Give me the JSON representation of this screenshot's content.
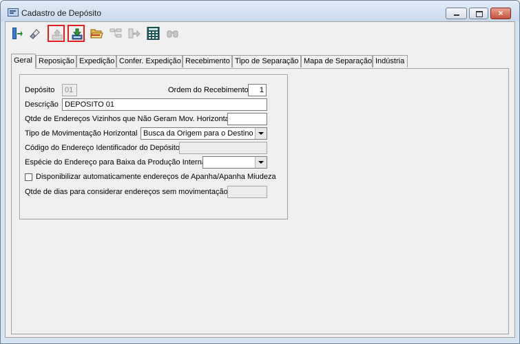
{
  "window": {
    "title": "Cadastro de Depósito",
    "close_glyph": "×"
  },
  "toolbar": {
    "buttons": [
      {
        "icon": "exit-icon"
      },
      {
        "icon": "eraser-icon"
      },
      {
        "icon": "insert-icon",
        "state": "disabled"
      },
      {
        "icon": "save-icon"
      },
      {
        "icon": "open-folder-icon"
      },
      {
        "icon": "tree-icon",
        "state": "disabled"
      },
      {
        "icon": "transfer-icon",
        "state": "disabled"
      },
      {
        "icon": "calculator-icon"
      },
      {
        "icon": "binoculars-icon",
        "state": "disabled"
      }
    ]
  },
  "tabs": [
    "Geral",
    "Reposição",
    "Expedição",
    "Confer. Expedição",
    "Recebimento",
    "Tipo de Separação",
    "Mapa de Separação",
    "Indústria"
  ],
  "selected_tab": "Geral",
  "form": {
    "deposito_label": "Depósito",
    "deposito_value": "01",
    "ordem_label": "Ordem do Recebimento",
    "ordem_value": "1",
    "descricao_label": "Descrição",
    "descricao_value": "DEPOSITO 01",
    "qtde_vizinhos_label": "Qtde de Endereços Vizinhos que Não Geram Mov. Horizontal",
    "qtde_vizinhos_value": "",
    "tipo_mov_label": "Tipo de Movimentação Horizontal",
    "tipo_mov_value": "Busca da Origem para o Destino",
    "codigo_endereco_label": "Código do Endereço Identificador do Depósito",
    "codigo_endereco_value": "",
    "especie_label": "Espécie do Endereço para Baixa da Produção Interna",
    "especie_value": "",
    "disponibilizar_label": "Disponibilizar automaticamente endereços de Apanha/Apanha Miudeza",
    "disponibilizar_checked": false,
    "qtde_dias_label": "Qtde de dias para considerar endereços sem movimentação",
    "qtde_dias_value": ""
  }
}
